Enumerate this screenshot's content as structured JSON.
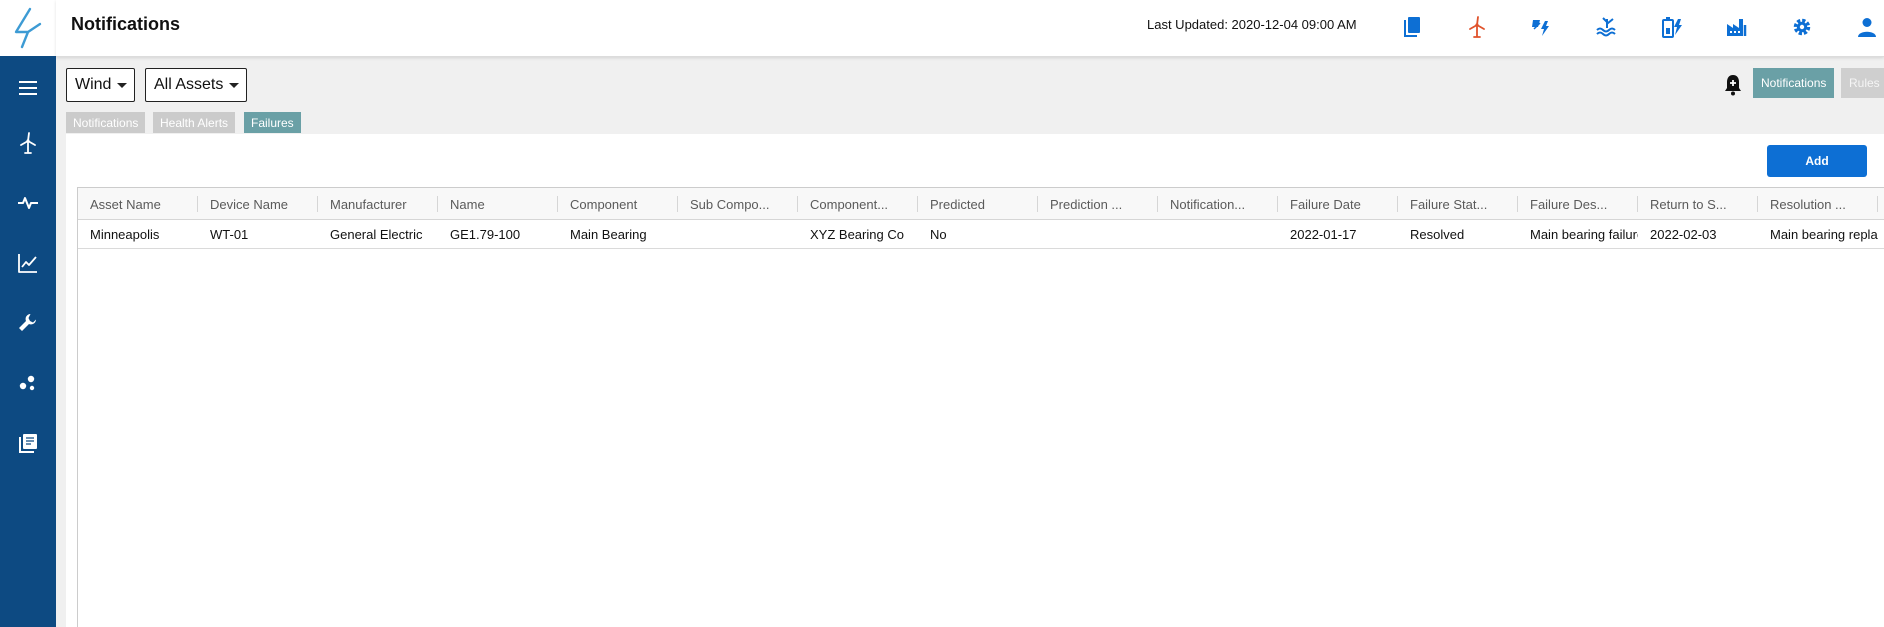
{
  "header": {
    "title": "Notifications",
    "last_updated": "Last Updated: 2020-12-04 09:00 AM"
  },
  "header_icons": [
    "reports-icon",
    "wind-turbine-icon",
    "solar-power-icon",
    "hydro-icon",
    "battery-storage-icon",
    "factory-icon",
    "settings-gear-icon",
    "user-account-icon"
  ],
  "sidebar_icons": [
    "menu-icon",
    "wind-turbine-icon",
    "pulse-icon",
    "trend-chart-icon",
    "wrench-icon",
    "scatter-dots-icon",
    "library-icon"
  ],
  "filters": {
    "technology": "Wind",
    "assets": "All Assets"
  },
  "view_toggle": {
    "notifications": "Notifications",
    "rules": "Rules"
  },
  "tabs": [
    {
      "label": "Notifications",
      "active": false
    },
    {
      "label": "Health Alerts",
      "active": false
    },
    {
      "label": "Failures",
      "active": true
    }
  ],
  "add_label": "Add",
  "table": {
    "columns": [
      "Asset Name",
      "Device Name",
      "Manufacturer",
      "Name",
      "Component",
      "Sub Compo...",
      "Component...",
      "Predicted",
      "Prediction ...",
      "Notification...",
      "Failure Date",
      "Failure Stat...",
      "Failure Des...",
      "Return to S...",
      "Resolution ..."
    ],
    "rows": [
      [
        "Minneapolis",
        "WT-01",
        "General Electric",
        "GE1.79-100",
        "Main Bearing",
        "",
        "XYZ Bearing Co",
        "No",
        "",
        "",
        "2022-01-17",
        "Resolved",
        "Main bearing failure",
        "2022-02-03",
        "Main bearing replaced"
      ]
    ]
  },
  "colors": {
    "sidebar": "#0d4a82",
    "primary": "#0d6fd4",
    "tab_active": "#6aa0a6",
    "tab_inactive": "#cbcbcb",
    "wind_icon": "#e0522b"
  }
}
